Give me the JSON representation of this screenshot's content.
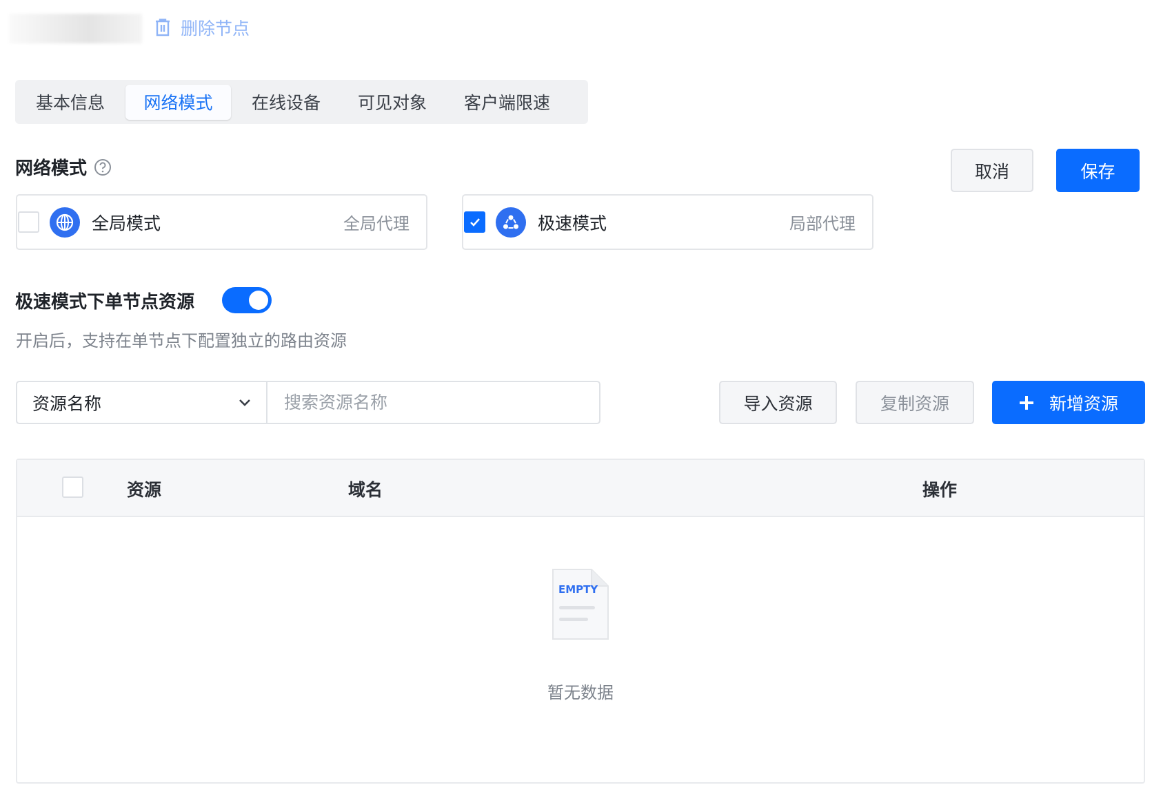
{
  "header": {
    "delete_node_label": "删除节点"
  },
  "tabs": [
    {
      "label": "基本信息"
    },
    {
      "label": "网络模式",
      "active": true
    },
    {
      "label": "在线设备"
    },
    {
      "label": "可见对象"
    },
    {
      "label": "客户端限速"
    }
  ],
  "network_mode": {
    "title": "网络模式",
    "cancel_label": "取消",
    "save_label": "保存",
    "options": [
      {
        "label": "全局模式",
        "desc": "全局代理",
        "checked": false,
        "icon": "globe-icon"
      },
      {
        "label": "极速模式",
        "desc": "局部代理",
        "checked": true,
        "icon": "share-nodes-icon"
      }
    ]
  },
  "single_node": {
    "title": "极速模式下单节点资源",
    "enabled": true,
    "description": "开启后，支持在单节点下配置独立的路由资源"
  },
  "filter": {
    "select_value": "资源名称",
    "search_placeholder": "搜索资源名称",
    "search_value": ""
  },
  "actions": {
    "import_label": "导入资源",
    "copy_label": "复制资源",
    "add_label": "新增资源"
  },
  "table": {
    "columns": [
      "资源",
      "域名",
      "操作"
    ],
    "rows": [],
    "empty_icon_text": "EMPTY",
    "empty_text": "暂无数据"
  },
  "colors": {
    "primary": "#0a6cff",
    "link_light": "#8fb4f7"
  }
}
